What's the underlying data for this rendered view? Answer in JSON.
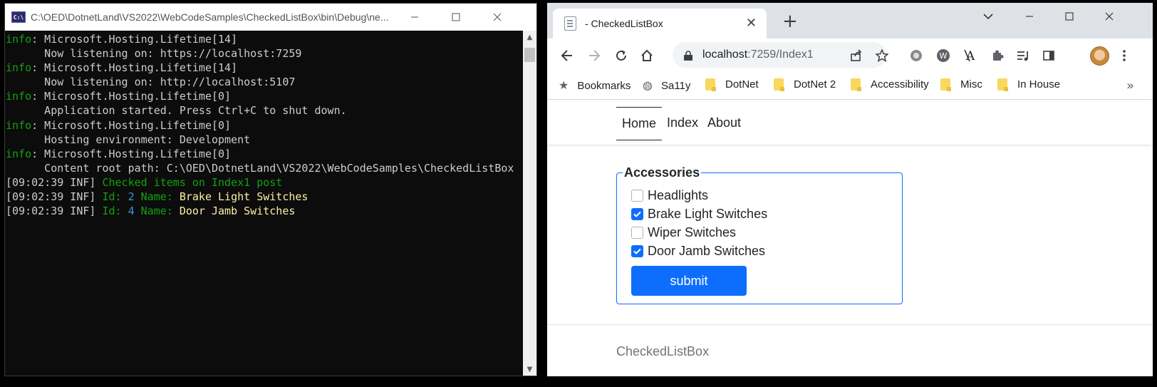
{
  "console": {
    "title": "C:\\OED\\DotnetLand\\VS2022\\WebCodeSamples\\CheckedListBox\\bin\\Debug\\ne...",
    "icon": "console-app-icon",
    "lines": [
      {
        "segs": [
          {
            "t": "info",
            "c": "green"
          },
          {
            "t": ": Microsoft.Hosting.Lifetime[14]",
            "c": ""
          }
        ]
      },
      {
        "segs": [
          {
            "t": "      Now listening on: https://localhost:7259",
            "c": ""
          }
        ]
      },
      {
        "segs": [
          {
            "t": "info",
            "c": "green"
          },
          {
            "t": ": Microsoft.Hosting.Lifetime[14]",
            "c": ""
          }
        ]
      },
      {
        "segs": [
          {
            "t": "      Now listening on: http://localhost:5107",
            "c": ""
          }
        ]
      },
      {
        "segs": [
          {
            "t": "info",
            "c": "green"
          },
          {
            "t": ": Microsoft.Hosting.Lifetime[0]",
            "c": ""
          }
        ]
      },
      {
        "segs": [
          {
            "t": "      Application started. Press Ctrl+C to shut down.",
            "c": ""
          }
        ]
      },
      {
        "segs": [
          {
            "t": "info",
            "c": "green"
          },
          {
            "t": ": Microsoft.Hosting.Lifetime[0]",
            "c": ""
          }
        ]
      },
      {
        "segs": [
          {
            "t": "      Hosting environment: Development",
            "c": ""
          }
        ]
      },
      {
        "segs": [
          {
            "t": "info",
            "c": "green"
          },
          {
            "t": ": Microsoft.Hosting.Lifetime[0]",
            "c": ""
          }
        ]
      },
      {
        "segs": [
          {
            "t": "      Content root path: C:\\OED\\DotnetLand\\VS2022\\WebCodeSamples\\CheckedListBox",
            "c": ""
          }
        ]
      },
      {
        "segs": [
          {
            "t": "[09:02:39 INF] ",
            "c": ""
          },
          {
            "t": "Checked items on Index1 post",
            "c": "green"
          }
        ]
      },
      {
        "segs": [
          {
            "t": "[09:02:39 INF] ",
            "c": ""
          },
          {
            "t": "Id: ",
            "c": "green"
          },
          {
            "t": "2",
            "c": "cyan"
          },
          {
            "t": " Name: ",
            "c": "green"
          },
          {
            "t": "Brake Light Switches",
            "c": "yellow"
          }
        ]
      },
      {
        "segs": [
          {
            "t": "[09:02:39 INF] ",
            "c": ""
          },
          {
            "t": "Id: ",
            "c": "green"
          },
          {
            "t": "4",
            "c": "cyan"
          },
          {
            "t": " Name: ",
            "c": "green"
          },
          {
            "t": "Door Jamb Switches",
            "c": "yellow"
          }
        ]
      }
    ]
  },
  "browser": {
    "tab_title": "- CheckedListBox",
    "tab_close": "✕",
    "new_tab": "+",
    "url_host": "localhost",
    "url_path": ":7259/Index1",
    "bookmarks": [
      {
        "label": "Bookmarks",
        "icon": "star-icon"
      },
      {
        "label": "Sa11y",
        "icon": "globe-icon"
      },
      {
        "label": "DotNet",
        "icon": "folder-icon"
      },
      {
        "label": "DotNet 2",
        "icon": "folder-icon"
      },
      {
        "label": "Accessibility",
        "icon": "folder-icon"
      },
      {
        "label": "Misc",
        "icon": "folder-icon"
      },
      {
        "label": "In House",
        "icon": "folder-icon"
      }
    ],
    "bookmarks_more": "»"
  },
  "page": {
    "nav": [
      "Home",
      "Index",
      "About"
    ],
    "active_nav": "Home",
    "legend": "Accessories",
    "options": [
      {
        "label": "Headlights",
        "checked": false
      },
      {
        "label": "Brake Light Switches",
        "checked": true
      },
      {
        "label": "Wiper Switches",
        "checked": false
      },
      {
        "label": "Door Jamb Switches",
        "checked": true
      }
    ],
    "submit_label": "submit",
    "footer": "CheckedListBox"
  },
  "colors": {
    "accent": "#0d6efd",
    "console_bg": "#0c0c0c",
    "console_green": "#13a10e",
    "console_yellow": "#f9f1a5",
    "console_cyan": "#3a96dd"
  }
}
